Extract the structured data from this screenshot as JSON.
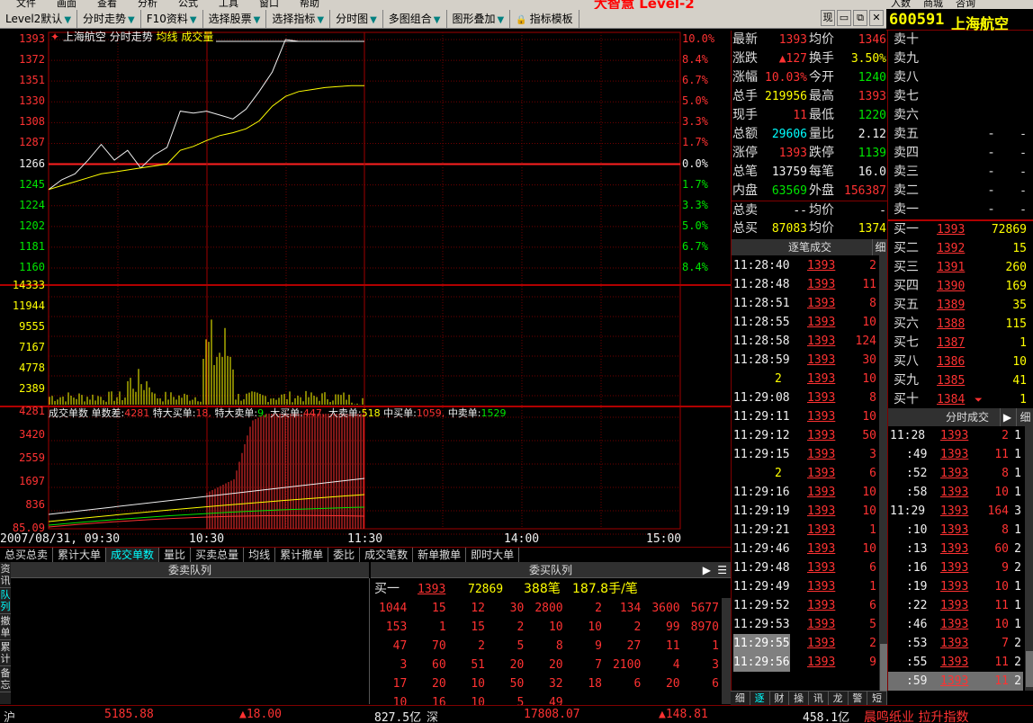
{
  "menubar": {
    "items": [
      "文件",
      "画面",
      "查看",
      "分析",
      "公式",
      "工具",
      "窗口",
      "帮助"
    ],
    "brand": "大智慧 Level-2",
    "right_items": [
      "入数",
      "商城",
      "咨询"
    ]
  },
  "toolbar": {
    "items": [
      "Level2默认",
      "分时走势",
      "F10资料",
      "选择股票",
      "选择指标",
      "分时图",
      "多图组合",
      "图形叠加",
      "指标模板"
    ],
    "right_label": "现"
  },
  "stock": {
    "code": "600591",
    "name": "上海航空"
  },
  "chart": {
    "legend": {
      "name": "上海航空",
      "type": "分时走势",
      "avg": "均线",
      "vol": "成交量"
    },
    "price_labels": [
      "1393",
      "1372",
      "1351",
      "1330",
      "1308",
      "1287",
      "1266",
      "1245",
      "1224",
      "1202",
      "1181",
      "1160"
    ],
    "pct_labels": [
      "10.0%",
      "8.4%",
      "6.7%",
      "5.0%",
      "3.3%",
      "1.7%",
      "0.0%",
      "1.7%",
      "3.3%",
      "5.0%",
      "6.7%",
      "8.4%"
    ],
    "vol_labels": [
      "14333",
      "11944",
      "9555",
      "7167",
      "4778",
      "2389"
    ],
    "ind_labels": [
      "4281",
      "3420",
      "2559",
      "1697",
      "836",
      "85.09"
    ],
    "ind_title": "成交单数",
    "ind_items": [
      {
        "k": "单数差:",
        "v": "4281",
        "c": "#ff3232"
      },
      {
        "k": "特大买单:",
        "v": "18,",
        "c": "#ff3232"
      },
      {
        "k": "特大卖单:",
        "v": "9,",
        "c": "#00e600"
      },
      {
        "k": "大买单:",
        "v": "447,",
        "c": "#ff3232"
      },
      {
        "k": "大卖单:",
        "v": "518",
        "c": "#ffff00"
      },
      {
        "k": "中买单:",
        "v": "1059,",
        "c": "#ff3232"
      },
      {
        "k": "中卖单:",
        "v": "1529",
        "c": "#00e600"
      }
    ],
    "x_labels": [
      "2007/08/31, 09:30",
      "10:30",
      "11:30",
      "14:00",
      "15:00"
    ]
  },
  "chart_data": {
    "type": "line",
    "title": "上海航空 分时走势",
    "x": [
      "09:30",
      "09:35",
      "09:40",
      "09:45",
      "09:50",
      "09:55",
      "10:00",
      "10:05",
      "10:10",
      "10:15",
      "10:20",
      "10:25",
      "10:30",
      "10:35",
      "10:40",
      "10:45",
      "10:50",
      "10:55",
      "11:00",
      "11:05",
      "11:10",
      "11:15",
      "11:20",
      "11:25",
      "11:30"
    ],
    "series": [
      {
        "name": "上海航空",
        "values": [
          1240,
          1250,
          1256,
          1270,
          1286,
          1270,
          1280,
          1262,
          1275,
          1283,
          1320,
          1318,
          1320,
          1316,
          1312,
          1322,
          1340,
          1360,
          1393,
          1393,
          1393,
          1393,
          1393,
          1393,
          1393
        ]
      },
      {
        "name": "均线",
        "values": [
          1240,
          1244,
          1248,
          1252,
          1256,
          1258,
          1260,
          1262,
          1264,
          1266,
          1280,
          1284,
          1290,
          1295,
          1298,
          1302,
          1310,
          1325,
          1335,
          1340,
          1342,
          1344,
          1345,
          1346,
          1346
        ]
      }
    ],
    "ylim": [
      1160,
      1393
    ],
    "volume_max": 14333
  },
  "quote": {
    "rows": [
      [
        {
          "k": "最新",
          "v": "1393",
          "c": "#ff3232"
        },
        {
          "k": "均价",
          "v": "1346",
          "c": "#ff3232"
        }
      ],
      [
        {
          "k": "涨跌",
          "v": "▲127",
          "c": "#ff3232"
        },
        {
          "k": "换手",
          "v": "3.50%",
          "c": "#ffff00"
        }
      ],
      [
        {
          "k": "涨幅",
          "v": "10.03%",
          "c": "#ff3232"
        },
        {
          "k": "今开",
          "v": "1240",
          "c": "#00e600"
        }
      ],
      [
        {
          "k": "总手",
          "v": "219956",
          "c": "#ffff00"
        },
        {
          "k": "最高",
          "v": "1393",
          "c": "#ff3232"
        }
      ],
      [
        {
          "k": "现手",
          "v": "11",
          "c": "#ff3232"
        },
        {
          "k": "最低",
          "v": "1220",
          "c": "#00e600"
        }
      ],
      [
        {
          "k": "总额",
          "v": "29606",
          "c": "#00ffff"
        },
        {
          "k": "量比",
          "v": "2.12",
          "c": "#f0f0f0"
        }
      ],
      [
        {
          "k": "涨停",
          "v": "1393",
          "c": "#ff3232"
        },
        {
          "k": "跌停",
          "v": "1139",
          "c": "#00e600"
        }
      ],
      [
        {
          "k": "总笔",
          "v": "13759",
          "c": "#f0f0f0"
        },
        {
          "k": "每笔",
          "v": "16.0",
          "c": "#f0f0f0"
        }
      ],
      [
        {
          "k": "内盘",
          "v": "63569",
          "c": "#00e600"
        },
        {
          "k": "外盘",
          "v": "156387",
          "c": "#ff3232"
        }
      ],
      [
        {
          "k": "总卖",
          "v": "--",
          "c": "#f0f0f0"
        },
        {
          "k": "均价",
          "v": "-",
          "c": "#f0f0f0"
        }
      ],
      [
        {
          "k": "总买",
          "v": "87083",
          "c": "#ffff00"
        },
        {
          "k": "均价",
          "v": "1374",
          "c": "#ffff00"
        }
      ]
    ]
  },
  "ticks": {
    "title": "逐笔成交",
    "detail": "细",
    "rows": [
      {
        "t": "11:28:40",
        "p": "1393",
        "q": "2"
      },
      {
        "t": "11:28:48",
        "p": "1393",
        "q": "11"
      },
      {
        "t": "11:28:51",
        "p": "1393",
        "q": "8"
      },
      {
        "t": "11:28:55",
        "p": "1393",
        "q": "10"
      },
      {
        "t": "11:28:58",
        "p": "1393",
        "q": "124"
      },
      {
        "t": "11:28:59",
        "p": "1393",
        "q": "30"
      },
      {
        "t": "2",
        "p": "1393",
        "q": "10"
      },
      {
        "t": "11:29:08",
        "p": "1393",
        "q": "8"
      },
      {
        "t": "11:29:11",
        "p": "1393",
        "q": "10"
      },
      {
        "t": "11:29:12",
        "p": "1393",
        "q": "50"
      },
      {
        "t": "11:29:15",
        "p": "1393",
        "q": "3"
      },
      {
        "t": "2",
        "p": "1393",
        "q": "6"
      },
      {
        "t": "11:29:16",
        "p": "1393",
        "q": "10"
      },
      {
        "t": "11:29:19",
        "p": "1393",
        "q": "10"
      },
      {
        "t": "11:29:21",
        "p": "1393",
        "q": "1"
      },
      {
        "t": "11:29:46",
        "p": "1393",
        "q": "10"
      },
      {
        "t": "11:29:48",
        "p": "1393",
        "q": "6"
      },
      {
        "t": "11:29:49",
        "p": "1393",
        "q": "1"
      },
      {
        "t": "11:29:52",
        "p": "1393",
        "q": "6"
      },
      {
        "t": "11:29:53",
        "p": "1393",
        "q": "5"
      },
      {
        "t": "11:29:55",
        "p": "1393",
        "q": "2"
      },
      {
        "t": "11:29:56",
        "p": "1393",
        "q": "9"
      }
    ]
  },
  "minitabs": [
    "细",
    "逐",
    "财",
    "操",
    "讯",
    "龙",
    "警",
    "短"
  ],
  "book": {
    "sells": [
      {
        "l": "卖十",
        "p": "",
        "q": ""
      },
      {
        "l": "卖九",
        "p": "",
        "q": ""
      },
      {
        "l": "卖八",
        "p": "",
        "q": ""
      },
      {
        "l": "卖七",
        "p": "",
        "q": ""
      },
      {
        "l": "卖六",
        "p": "",
        "q": ""
      },
      {
        "l": "卖五",
        "p": "",
        "q": "-"
      },
      {
        "l": "卖四",
        "p": "",
        "q": "-"
      },
      {
        "l": "卖三",
        "p": "",
        "q": "-"
      },
      {
        "l": "卖二",
        "p": "",
        "q": "-"
      },
      {
        "l": "卖一",
        "p": "",
        "q": "-"
      }
    ],
    "buys": [
      {
        "l": "买一",
        "p": "1393",
        "q": "72869"
      },
      {
        "l": "买二",
        "p": "1392",
        "q": "15"
      },
      {
        "l": "买三",
        "p": "1391",
        "q": "260"
      },
      {
        "l": "买四",
        "p": "1390",
        "q": "169"
      },
      {
        "l": "买五",
        "p": "1389",
        "q": "35"
      },
      {
        "l": "买六",
        "p": "1388",
        "q": "115"
      },
      {
        "l": "买七",
        "p": "1387",
        "q": "1"
      },
      {
        "l": "买八",
        "p": "1386",
        "q": "10"
      },
      {
        "l": "买九",
        "p": "1385",
        "q": "41"
      },
      {
        "l": "买十",
        "p": "1384",
        "q": "1"
      }
    ]
  },
  "mtrades": {
    "title": "分时成交",
    "detail": "细",
    "rows": [
      {
        "t": "11:28",
        "p": "1393",
        "q": "2",
        "n": "1"
      },
      {
        "t": ":49",
        "p": "1393",
        "q": "11",
        "n": "1"
      },
      {
        "t": ":52",
        "p": "1393",
        "q": "8",
        "n": "1"
      },
      {
        "t": ":58",
        "p": "1393",
        "q": "10",
        "n": "1"
      },
      {
        "t": "11:29",
        "p": "1393",
        "q": "164",
        "n": "3"
      },
      {
        "t": ":10",
        "p": "1393",
        "q": "8",
        "n": "1"
      },
      {
        "t": ":13",
        "p": "1393",
        "q": "60",
        "n": "2"
      },
      {
        "t": ":16",
        "p": "1393",
        "q": "9",
        "n": "2"
      },
      {
        "t": ":19",
        "p": "1393",
        "q": "10",
        "n": "1"
      },
      {
        "t": ":22",
        "p": "1393",
        "q": "11",
        "n": "1"
      },
      {
        "t": ":46",
        "p": "1393",
        "q": "10",
        "n": "1"
      },
      {
        "t": ":53",
        "p": "1393",
        "q": "7",
        "n": "2"
      },
      {
        "t": ":55",
        "p": "1393",
        "q": "11",
        "n": "2"
      },
      {
        "t": ":59",
        "p": "1393",
        "q": "11",
        "n": "2"
      }
    ]
  },
  "tabs": [
    "总买总卖",
    "累计大单",
    "成交单数",
    "量比",
    "买卖总量",
    "均线",
    "累计撤单",
    "委比",
    "成交笔数",
    "新单撤单",
    "即时大单"
  ],
  "queue": {
    "sell_title": "委卖队列",
    "buy_title": "委买队列",
    "side_tabs": [
      "资讯",
      "队列",
      "撤单",
      "累计",
      "备忘"
    ],
    "header": {
      "label": "买一",
      "price": "1393",
      "qty": "72869",
      "count": "388笔",
      "avg": "187.8手/笔"
    },
    "rows": [
      [
        "1044",
        "15",
        "12",
        "30",
        "2800",
        "2",
        "134",
        "3600",
        "5677"
      ],
      [
        "153",
        "1",
        "15",
        "2",
        "10",
        "10",
        "2",
        "99",
        "8970"
      ],
      [
        "47",
        "70",
        "2",
        "5",
        "8",
        "9",
        "27",
        "11",
        "1"
      ],
      [
        "3",
        "60",
        "51",
        "20",
        "20",
        "7",
        "2100",
        "4",
        "3"
      ],
      [
        "17",
        "20",
        "10",
        "50",
        "32",
        "18",
        "6",
        "20",
        "6"
      ],
      [
        "10",
        "16",
        "10",
        "5",
        "49",
        "",
        "",
        "",
        ""
      ]
    ]
  },
  "status": {
    "sh_label": "沪",
    "sh_index": "5185.88",
    "sh_chg": "▲18.00",
    "sh_amt": "827.5亿",
    "sz_label": "深",
    "sz_index": "17808.07",
    "sz_chg": "▲148.81",
    "sz_amt": "458.1亿",
    "ticker": "晨鸣纸业 拉升指数"
  }
}
